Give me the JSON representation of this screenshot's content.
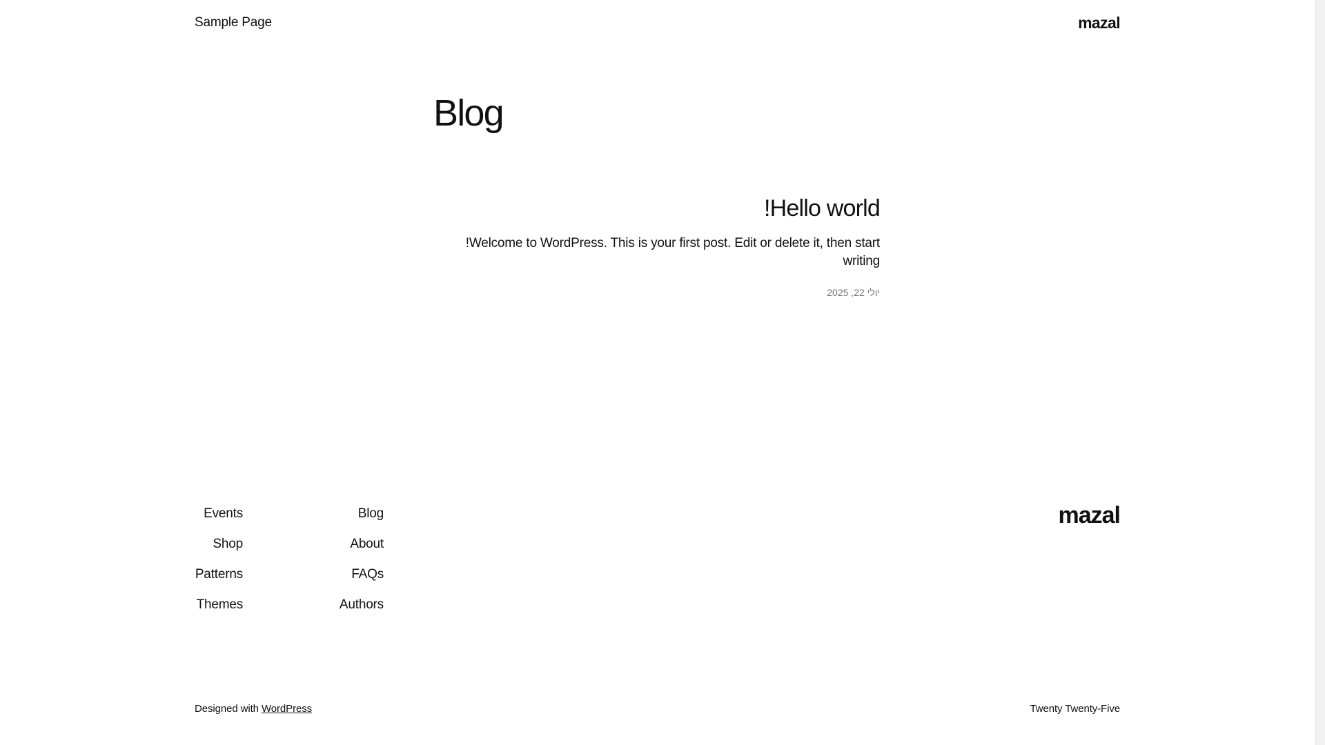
{
  "header": {
    "nav_link": "Sample Page",
    "site_title": "mazal"
  },
  "main": {
    "heading": "Blog",
    "posts": [
      {
        "title": "!Hello world",
        "excerpt": "!Welcome to WordPress. This is your first post. Edit or delete it, then start writing",
        "date": "יולי 22, 2025"
      }
    ]
  },
  "footer": {
    "site_title": "mazal",
    "nav_col_a": [
      "Blog",
      "About",
      "FAQs",
      "Authors"
    ],
    "nav_col_b": [
      "Events",
      "Shop",
      "Patterns",
      "Themes"
    ],
    "credit_prefix": "Designed with",
    "credit_link": "WordPress",
    "theme_name": "Twenty Twenty-Five"
  }
}
